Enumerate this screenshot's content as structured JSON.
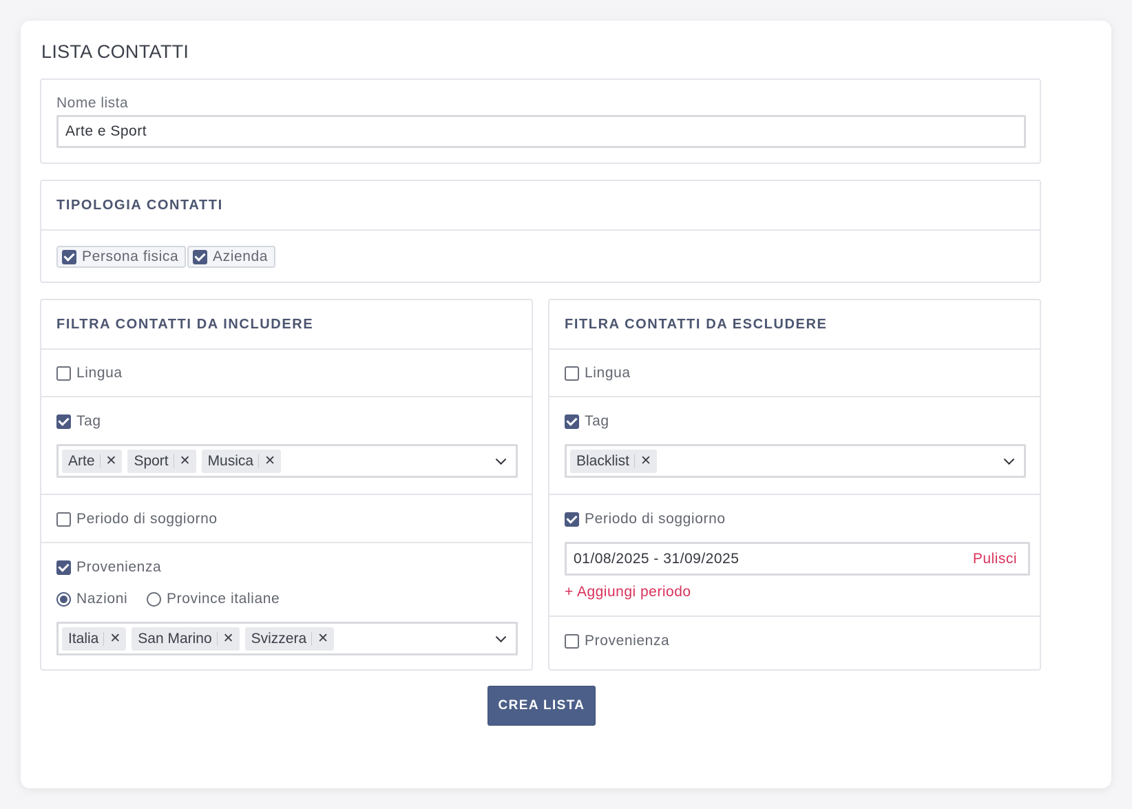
{
  "page": {
    "title": "LISTA CONTATTI"
  },
  "list_name": {
    "label": "Nome lista",
    "value": "Arte e Sport"
  },
  "contact_type": {
    "heading": "TIPOLOGIA CONTATTI",
    "options": [
      {
        "label": "Persona fisica",
        "checked": true
      },
      {
        "label": "Azienda",
        "checked": true
      }
    ]
  },
  "include": {
    "heading": "FILTRA CONTATTI DA INCLUDERE",
    "lingua": {
      "label": "Lingua",
      "checked": false
    },
    "tag": {
      "label": "Tag",
      "checked": true,
      "selected": [
        "Arte",
        "Sport",
        "Musica"
      ]
    },
    "periodo": {
      "label": "Periodo di soggiorno",
      "checked": false
    },
    "provenienza": {
      "label": "Provenienza",
      "checked": true,
      "radio_options": [
        "Nazioni",
        "Province italiane"
      ],
      "radio_selected": "Nazioni",
      "selected": [
        "Italia",
        "San Marino",
        "Svizzera"
      ]
    }
  },
  "exclude": {
    "heading": "FITLRA CONTATTI DA ESCLUDERE",
    "lingua": {
      "label": "Lingua",
      "checked": false
    },
    "tag": {
      "label": "Tag",
      "checked": true,
      "selected": [
        "Blacklist"
      ]
    },
    "periodo": {
      "label": "Periodo di soggiorno",
      "checked": true,
      "range": "01/08/2025 - 31/09/2025",
      "clear_label": "Pulisci",
      "add_label": "+ Aggiungi periodo"
    },
    "provenienza": {
      "label": "Provenienza",
      "checked": false
    }
  },
  "submit": {
    "label": "CREA LISTA"
  },
  "colors": {
    "primary": "#4c5f88",
    "accent_red": "#d9315a",
    "checkbox": "#4c5a82"
  },
  "icons": {
    "tag_remove": "close-icon",
    "dropdown": "chevron-down-icon",
    "checkbox": "checkmark-icon"
  }
}
